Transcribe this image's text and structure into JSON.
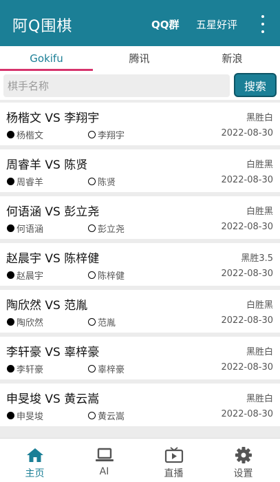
{
  "appbar": {
    "title": "阿Q围棋",
    "qq_group": "QQ群",
    "five_star": "五星好评"
  },
  "tabs": [
    {
      "label": "Gokifu"
    },
    {
      "label": "腾讯"
    },
    {
      "label": "新浪"
    }
  ],
  "search": {
    "placeholder": "棋手名称",
    "button": "搜索"
  },
  "games": [
    {
      "title": "杨楷文 VS 李翔宇",
      "result": "黑胜白",
      "black": "杨楷文",
      "white": "李翔宇",
      "date": "2022-08-30"
    },
    {
      "title": "周睿羊 VS 陈贤",
      "result": "白胜黑",
      "black": "周睿羊",
      "white": "陈贤",
      "date": "2022-08-30"
    },
    {
      "title": "何语涵 VS 彭立尧",
      "result": "白胜黑",
      "black": "何语涵",
      "white": "彭立尧",
      "date": "2022-08-30"
    },
    {
      "title": "赵晨宇 VS 陈梓健",
      "result": "黑胜3.5",
      "black": "赵晨宇",
      "white": "陈梓健",
      "date": "2022-08-30"
    },
    {
      "title": "陶欣然 VS 范胤",
      "result": "白胜黑",
      "black": "陶欣然",
      "white": "范胤",
      "date": "2022-08-30"
    },
    {
      "title": "李轩豪 VS 辜梓豪",
      "result": "黑胜白",
      "black": "李轩豪",
      "white": "辜梓豪",
      "date": "2022-08-30"
    },
    {
      "title": "申旻埈 VS 黄云嵩",
      "result": "黑胜白",
      "black": "申旻埈",
      "white": "黄云嵩",
      "date": "2022-08-30"
    }
  ],
  "bottom_nav": [
    {
      "label": "主页",
      "icon": "home-icon"
    },
    {
      "label": "AI",
      "icon": "laptop-icon"
    },
    {
      "label": "直播",
      "icon": "tv-icon"
    },
    {
      "label": "设置",
      "icon": "gear-icon"
    }
  ],
  "colors": {
    "primary": "#1b7f96",
    "tab_indicator": "#d6336c"
  }
}
